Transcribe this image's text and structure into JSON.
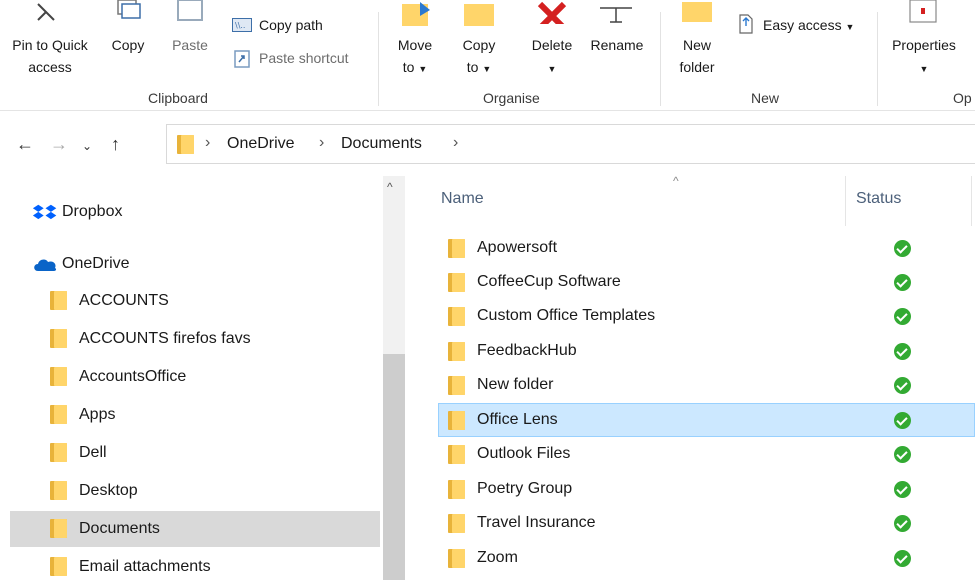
{
  "ribbon": {
    "clipboard": {
      "pin_label_1": "Pin to Quick",
      "pin_label_2": "access",
      "copy_label": "Copy",
      "paste_label": "Paste",
      "copy_path_label": "Copy path",
      "paste_shortcut_label": "Paste shortcut",
      "group_label": "Clipboard"
    },
    "organise": {
      "move_label_1": "Move",
      "move_label_2": "to",
      "copy_to_label_1": "Copy",
      "copy_to_label_2": "to",
      "delete_label": "Delete",
      "rename_label": "Rename",
      "group_label": "Organise"
    },
    "new": {
      "new_folder_label_1": "New",
      "new_folder_label_2": "folder",
      "easy_access_label": "Easy access",
      "group_label": "New"
    },
    "open": {
      "properties_label": "Properties",
      "group_label": "Op"
    }
  },
  "address": {
    "crumbs": [
      "OneDrive",
      "Documents"
    ]
  },
  "nav": {
    "items": [
      {
        "label": "Dropbox",
        "icon": "dropbox-icon"
      },
      {
        "label": "OneDrive",
        "icon": "onedrive-cloud-icon"
      },
      {
        "label": "ACCOUNTS",
        "icon": "folder-icon"
      },
      {
        "label": "ACCOUNTS firefos favs",
        "icon": "folder-icon"
      },
      {
        "label": "AccountsOffice",
        "icon": "folder-icon"
      },
      {
        "label": "Apps",
        "icon": "folder-icon"
      },
      {
        "label": "Dell",
        "icon": "folder-icon"
      },
      {
        "label": "Desktop",
        "icon": "folder-icon"
      },
      {
        "label": "Documents",
        "icon": "folder-icon",
        "selected": true
      },
      {
        "label": "Email attachments",
        "icon": "folder-icon"
      }
    ]
  },
  "list": {
    "columns": [
      "Name",
      "Status"
    ],
    "rows": [
      {
        "name": "Apowersoft"
      },
      {
        "name": "CoffeeCup Software"
      },
      {
        "name": "Custom Office Templates"
      },
      {
        "name": "FeedbackHub"
      },
      {
        "name": "New folder"
      },
      {
        "name": "Office Lens",
        "selected": true
      },
      {
        "name": "Outlook Files"
      },
      {
        "name": "Poetry Group"
      },
      {
        "name": "Travel Insurance"
      },
      {
        "name": "Zoom"
      }
    ]
  },
  "colors": {
    "selection": "#cce8ff",
    "nav_selection": "#d9d9d9",
    "folder": "#ffd56a",
    "status_ok": "#33aa33",
    "onedrive": "#0a64c8",
    "dropbox": "#0061fe"
  }
}
